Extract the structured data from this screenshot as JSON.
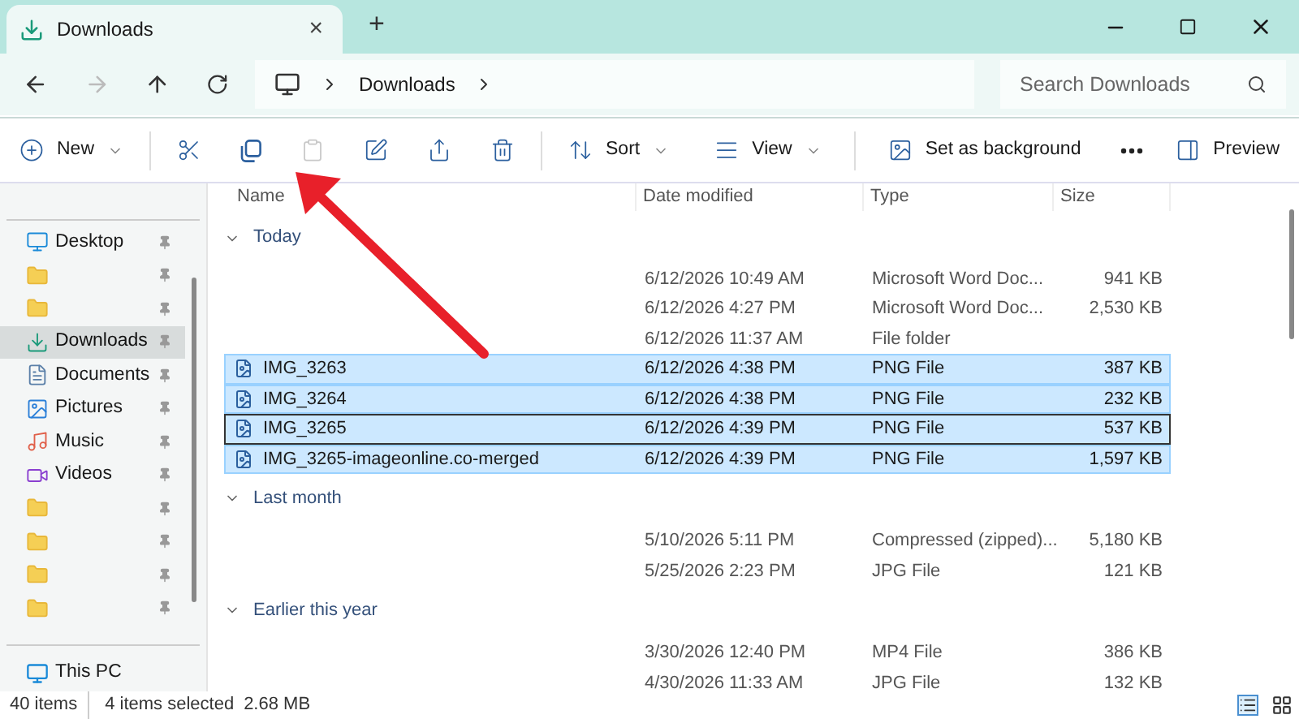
{
  "tab": {
    "title": "Downloads",
    "close": "×",
    "add": "+"
  },
  "address": {
    "crumbs": [
      "Downloads"
    ],
    "search": {
      "placeholder": "Search Downloads"
    }
  },
  "toolbar": [
    {
      "kind": "new",
      "label": "New",
      "disabled": false
    },
    {
      "kind": "cut",
      "disabled": false
    },
    {
      "kind": "copy",
      "disabled": false
    },
    {
      "kind": "paste",
      "disabled": true
    },
    {
      "kind": "rename",
      "disabled": false
    },
    {
      "kind": "share",
      "disabled": false
    },
    {
      "kind": "delete",
      "disabled": false
    },
    {
      "kind": "sort",
      "label": "Sort",
      "disabled": false
    },
    {
      "kind": "view",
      "label": "View",
      "disabled": false
    },
    {
      "kind": "background",
      "label": "Set as background",
      "disabled": false
    },
    {
      "kind": "more",
      "disabled": false
    },
    {
      "kind": "preview",
      "label": "Preview",
      "disabled": false
    }
  ],
  "sidebar": {
    "items": [
      {
        "kind": "desktop",
        "label": "Desktop",
        "selected": false
      },
      {
        "kind": "folder",
        "selected": false
      },
      {
        "kind": "folder",
        "selected": false
      },
      {
        "kind": "downloads",
        "label": "Downloads",
        "selected": true
      },
      {
        "kind": "documents",
        "label": "Documents",
        "selected": false
      },
      {
        "kind": "pictures",
        "label": "Pictures",
        "selected": false
      },
      {
        "kind": "music",
        "label": "Music",
        "selected": false
      },
      {
        "kind": "videos",
        "label": "Videos",
        "selected": false
      },
      {
        "kind": "folder",
        "selected": false
      },
      {
        "kind": "folder",
        "selected": false
      },
      {
        "kind": "folder",
        "selected": false
      },
      {
        "kind": "folder",
        "selected": false
      }
    ],
    "this_pc": "This PC"
  },
  "table": {
    "columns": [
      "Name",
      "Date modified",
      "Type",
      "Size"
    ],
    "groups": [
      {
        "title": "Today",
        "rows": [
          {
            "date": "6/12/2026 10:49 AM",
            "type": "Microsoft Word Doc...",
            "size": "941 KB",
            "selected": false,
            "focused": false
          },
          {
            "date": "6/12/2026 4:27 PM",
            "type": "Microsoft Word Doc...",
            "size": "2,530 KB",
            "selected": false,
            "focused": false
          },
          {
            "date": "6/12/2026 11:37 AM",
            "type": "File folder",
            "selected": false,
            "focused": false
          },
          {
            "name": "IMG_3263",
            "date": "6/12/2026 4:38 PM",
            "type": "PNG File",
            "size": "387 KB",
            "selected": true,
            "focused": false
          },
          {
            "name": "IMG_3264",
            "date": "6/12/2026 4:38 PM",
            "type": "PNG File",
            "size": "232 KB",
            "selected": true,
            "focused": false
          },
          {
            "name": "IMG_3265",
            "date": "6/12/2026 4:39 PM",
            "type": "PNG File",
            "size": "537 KB",
            "selected": true,
            "focused": true
          },
          {
            "name": "IMG_3265-imageonline.co-merged",
            "date": "6/12/2026 4:39 PM",
            "type": "PNG File",
            "size": "1,597 KB",
            "selected": true,
            "focused": false
          }
        ]
      },
      {
        "title": "Last month",
        "rows": [
          {
            "date": "5/10/2026 5:11 PM",
            "type": "Compressed (zipped)...",
            "size": "5,180 KB",
            "selected": false,
            "focused": false
          },
          {
            "date": "5/25/2026 2:23 PM",
            "type": "JPG File",
            "size": "121 KB",
            "selected": false,
            "focused": false
          }
        ]
      },
      {
        "title": "Earlier this year",
        "rows": [
          {
            "date": "3/30/2026 12:40 PM",
            "type": "MP4 File",
            "size": "386 KB",
            "selected": false,
            "focused": false
          },
          {
            "date": "4/30/2026 11:33 AM",
            "type": "JPG File",
            "size": "132 KB",
            "selected": false,
            "focused": false
          }
        ]
      }
    ]
  },
  "status_bar": {
    "count": "40 items",
    "selection": "4 items selected",
    "size": "2.68 MB"
  }
}
